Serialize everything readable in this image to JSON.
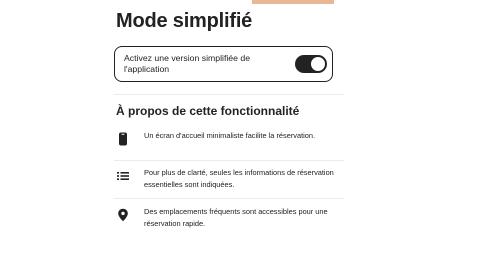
{
  "page_title": "Mode simplifié",
  "toggle": {
    "label": "Activez une version simplifiée de l'application",
    "enabled": true
  },
  "section_title": "À propos de cette fonctionnalité",
  "features": [
    {
      "icon": "phone-icon",
      "text": "Un écran d'accueil minimaliste facilite la réservation."
    },
    {
      "icon": "list-icon",
      "text": "Pour plus de clarté, seules les informations de réservation essentielles sont indiquées."
    },
    {
      "icon": "location-pin-icon",
      "text": "Des emplacements fréquents sont accessibles pour une réservation rapide."
    }
  ]
}
